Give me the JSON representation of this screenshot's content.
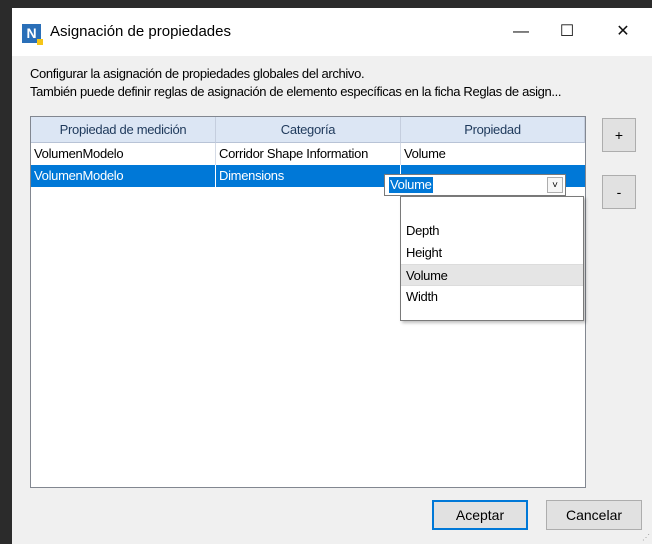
{
  "window": {
    "title": "Asignación de propiedades",
    "minimize": "—",
    "maximize": "☐",
    "close": "✕"
  },
  "description": {
    "line1": "Configurar la asignación de propiedades globales del archivo.",
    "line2": "También puede definir reglas de asignación de elemento específicas en la ficha Reglas de asign..."
  },
  "table": {
    "headers": [
      "Propiedad de medición",
      "Categoría",
      "Propiedad"
    ],
    "rows": [
      {
        "measurement": "VolumenModelo",
        "category": "Corridor Shape Information",
        "property": "Volume",
        "selected": false
      },
      {
        "measurement": "VolumenModelo",
        "category": "Dimensions",
        "property": "Volume",
        "selected": true
      }
    ]
  },
  "combo": {
    "value": "Volume",
    "arrow": "˅"
  },
  "dropdown": {
    "options": [
      "",
      "Depth",
      "Height",
      "Volume",
      "Width"
    ],
    "highlighted_index": 3
  },
  "side_buttons": {
    "add": "+",
    "remove": "-"
  },
  "buttons": {
    "accept": "Aceptar",
    "cancel": "Cancelar"
  },
  "colors": {
    "selection": "#0078d7",
    "header_bg": "#dce6f4",
    "header_text": "#1e395b"
  },
  "icons": {
    "app": "navisworks-icon",
    "grip": "resize-grip-icon"
  }
}
